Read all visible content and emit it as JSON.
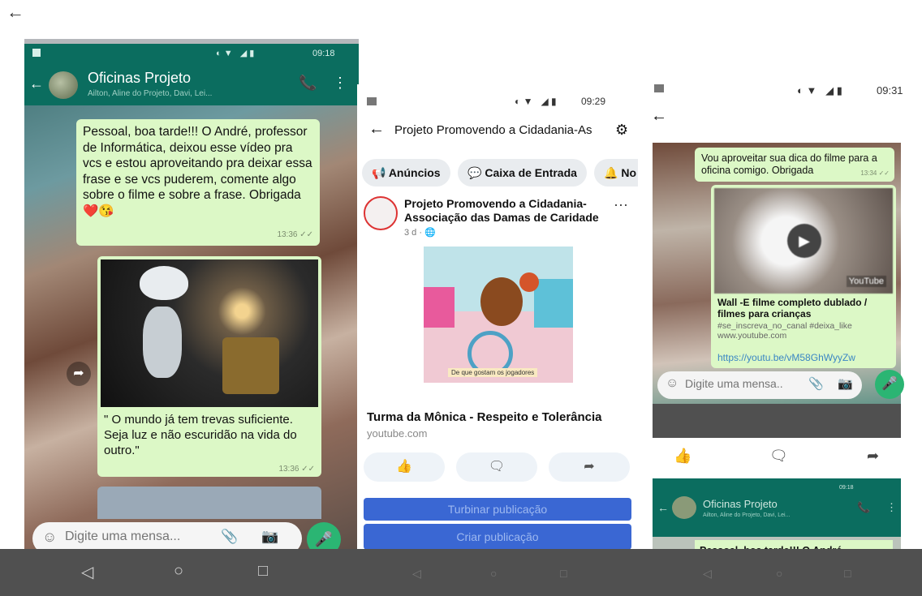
{
  "top_back_icon": "←",
  "whatsapp": {
    "status_time": "09:18",
    "chat_title": "Oficinas Projeto",
    "chat_subtitle": "Ailton, Aline do Projeto, Davi, Lei...",
    "message1": "Pessoal, boa tarde!!! O André, professor de Informática, deixou esse vídeo pra vcs e estou aproveitando pra deixar essa frase e se vcs puderem, comente algo sobre o filme e sobre a frase. Obrigada ❤️😘",
    "message1_time": "13:36 ✓✓",
    "message2_caption": "\" O mundo já tem trevas suficiente. Seja luz e não escuridão na vida do outro.\"",
    "message2_time": "13:36 ✓✓",
    "input_placeholder": "Digite uma mensa..."
  },
  "facebook": {
    "status_time": "09:29",
    "page_title": "Projeto Promovendo a Cidadania-As",
    "chips": [
      "Anúncios",
      "Caixa de Entrada",
      "No"
    ],
    "post_author": "Projeto Promovendo a Cidadania-Associação das Damas de Caridade",
    "post_meta": "3 d · 🌐",
    "thumbnail_caption": "De que gostam os jogadores",
    "link_title": "Turma da Mônica - Respeito e Tolerância",
    "link_domain": "youtube.com",
    "boost_button": "Turbinar publicação",
    "create_button": "Criar publicação"
  },
  "whatsapp2": {
    "status_time": "09:31",
    "message": "Vou aproveitar sua dica do filme para a oficina comigo. Obrigada",
    "message_time": "13:34 ✓✓",
    "youtube_label": "YouTube",
    "video_title": "Wall -E filme completo dublado / filmes para crianças",
    "video_desc": "#se_inscreva_no_canal #deixa_like www.youtube.com",
    "video_link": "https://youtu.be/vM58GhWyyZw",
    "input_placeholder": "Digite uma mensa...",
    "mini_chat_title": "Oficinas Projeto",
    "mini_chat_subtitle": "Ailton, Aline do Projeto, Davi, Lei...",
    "mini_status_time": "09:18",
    "mini_message": "Pessoal, boa tarde!!! O André,"
  }
}
